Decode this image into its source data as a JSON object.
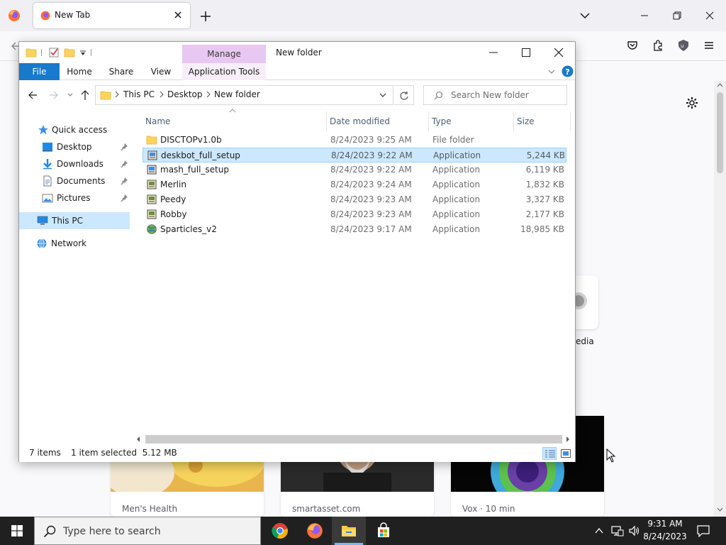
{
  "browser": {
    "tab_title": "New Tab",
    "shortcut_label": "edia",
    "stories": [
      {
        "source": "Men's Health"
      },
      {
        "source": "smartasset.com"
      },
      {
        "source": "Vox · 10 min"
      }
    ]
  },
  "explorer": {
    "manage_label": "Manage",
    "title": "New folder",
    "ribbon_tabs": {
      "file": "File",
      "home": "Home",
      "share": "Share",
      "view": "View",
      "app_tools": "Application Tools"
    },
    "breadcrumb": [
      "This PC",
      "Desktop",
      "New folder"
    ],
    "search_placeholder": "Search New folder",
    "nav": {
      "quick_access": "Quick access",
      "desktop": "Desktop",
      "downloads": "Downloads",
      "documents": "Documents",
      "pictures": "Pictures",
      "this_pc": "This PC",
      "network": "Network"
    },
    "columns": {
      "name": "Name",
      "date": "Date modified",
      "type": "Type",
      "size": "Size"
    },
    "files": [
      {
        "name": "DISCTOPv1.0b",
        "date": "8/24/2023 9:25 AM",
        "type": "File folder",
        "size": "",
        "icon": "folder-icon"
      },
      {
        "name": "deskbot_full_setup",
        "date": "8/24/2023 9:22 AM",
        "type": "Application",
        "size": "5,244 KB",
        "icon": "installer-icon",
        "selected": true
      },
      {
        "name": "mash_full_setup",
        "date": "8/24/2023 9:22 AM",
        "type": "Application",
        "size": "6,119 KB",
        "icon": "installer-icon"
      },
      {
        "name": "Merlin",
        "date": "8/24/2023 9:24 AM",
        "type": "Application",
        "size": "1,832 KB",
        "icon": "installer-icon"
      },
      {
        "name": "Peedy",
        "date": "8/24/2023 9:23 AM",
        "type": "Application",
        "size": "3,327 KB",
        "icon": "installer-icon"
      },
      {
        "name": "Robby",
        "date": "8/24/2023 9:23 AM",
        "type": "Application",
        "size": "2,177 KB",
        "icon": "installer-icon"
      },
      {
        "name": "Sparticles_v2",
        "date": "8/24/2023 9:17 AM",
        "type": "Application",
        "size": "18,985 KB",
        "icon": "globe-app-icon"
      }
    ],
    "status": {
      "item_count": "7 items",
      "selection": "1 item selected  5.12 MB"
    }
  },
  "taskbar": {
    "search_placeholder": "Type here to search",
    "time": "9:31 AM",
    "date": "8/24/2023"
  },
  "colors": {
    "accent": "#1979ca",
    "selection": "#cce8ff",
    "manage_tab": "#e8c7f2",
    "taskbar": "#202020"
  }
}
